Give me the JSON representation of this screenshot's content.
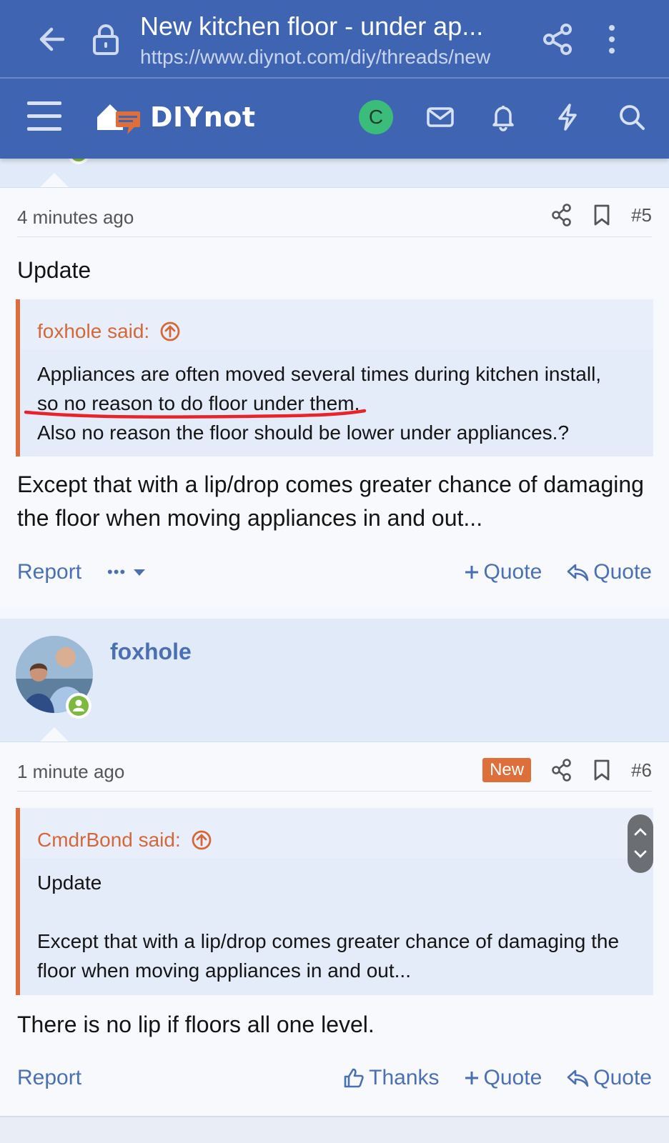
{
  "browser": {
    "title": "New kitchen floor - under ap...",
    "url": "https://www.diynot.com/diy/threads/new"
  },
  "site": {
    "logo_text": "DIYnot",
    "user_initial": "C"
  },
  "post5": {
    "time": "4 minutes ago",
    "number": "#5",
    "lead": "Update",
    "quote_author": "foxhole said:",
    "quote_line1": "Appliances are often moved several times during kitchen install,",
    "quote_line2": "so no reason to do floor under them.",
    "quote_line3": "Also no reason the floor should be lower under appliances.?",
    "body": "Except that with a lip/drop comes greater chance of damaging the floor when moving appliances in and out...",
    "actions": {
      "report": "Report",
      "more": "•••",
      "multi_quote": "Quote",
      "quote": "Quote"
    }
  },
  "post6": {
    "username": "foxhole",
    "time": "1 minute ago",
    "badge": "New",
    "number": "#6",
    "quote_author": "CmdrBond said:",
    "quote_line1": "Update",
    "quote_line2": "Except that with a lip/drop comes greater chance of damaging the floor when moving appliances in and out...",
    "body": "There is no lip if floors all one level.",
    "actions": {
      "report": "Report",
      "thanks": "Thanks",
      "multi_quote": "Quote",
      "quote": "Quote"
    }
  },
  "colors": {
    "header_bg": "#3f64b1",
    "accent_orange": "#dd6d3c",
    "link_blue": "#4a70b3",
    "annotation_red": "#e8232b",
    "online_green": "#7cb93f"
  }
}
